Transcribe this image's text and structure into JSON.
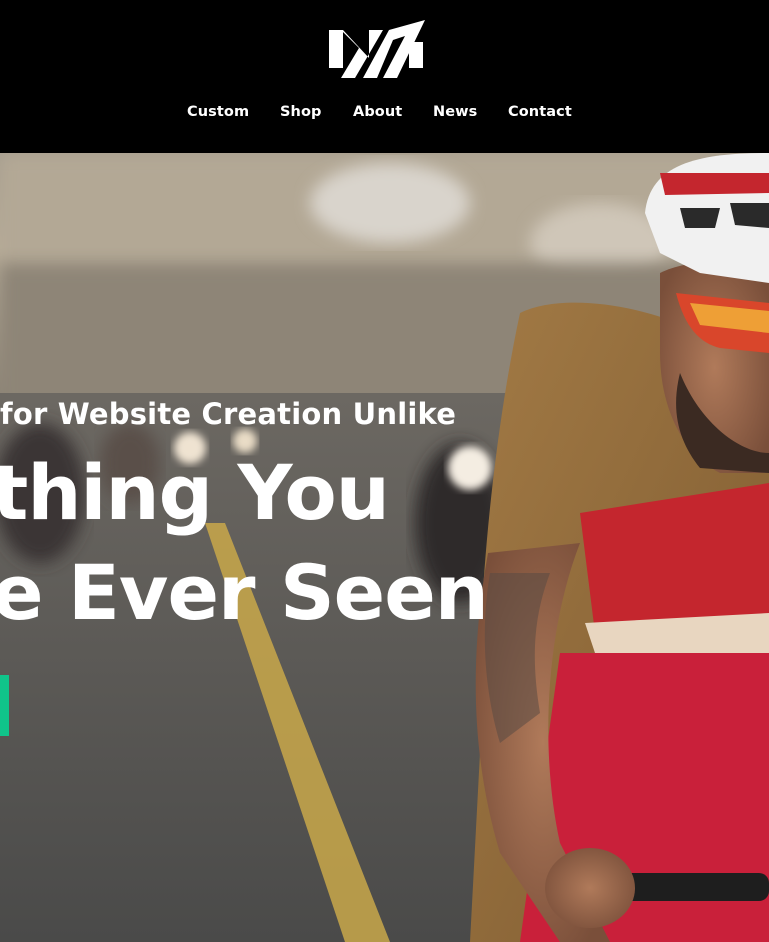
{
  "nav": {
    "items": [
      {
        "label": "Custom"
      },
      {
        "label": "Shop"
      },
      {
        "label": "About"
      },
      {
        "label": "News"
      },
      {
        "label": "Contact"
      }
    ]
  },
  "hero": {
    "tagline": "for Website Creation Unlike",
    "headline_line1": "thing You",
    "headline_line2": "e Ever Seen",
    "cta_label": ""
  },
  "colors": {
    "header_bg": "#000000",
    "nav_text": "#ffffff",
    "hero_text": "#ffffff",
    "cta_accent": "#10c48a"
  }
}
